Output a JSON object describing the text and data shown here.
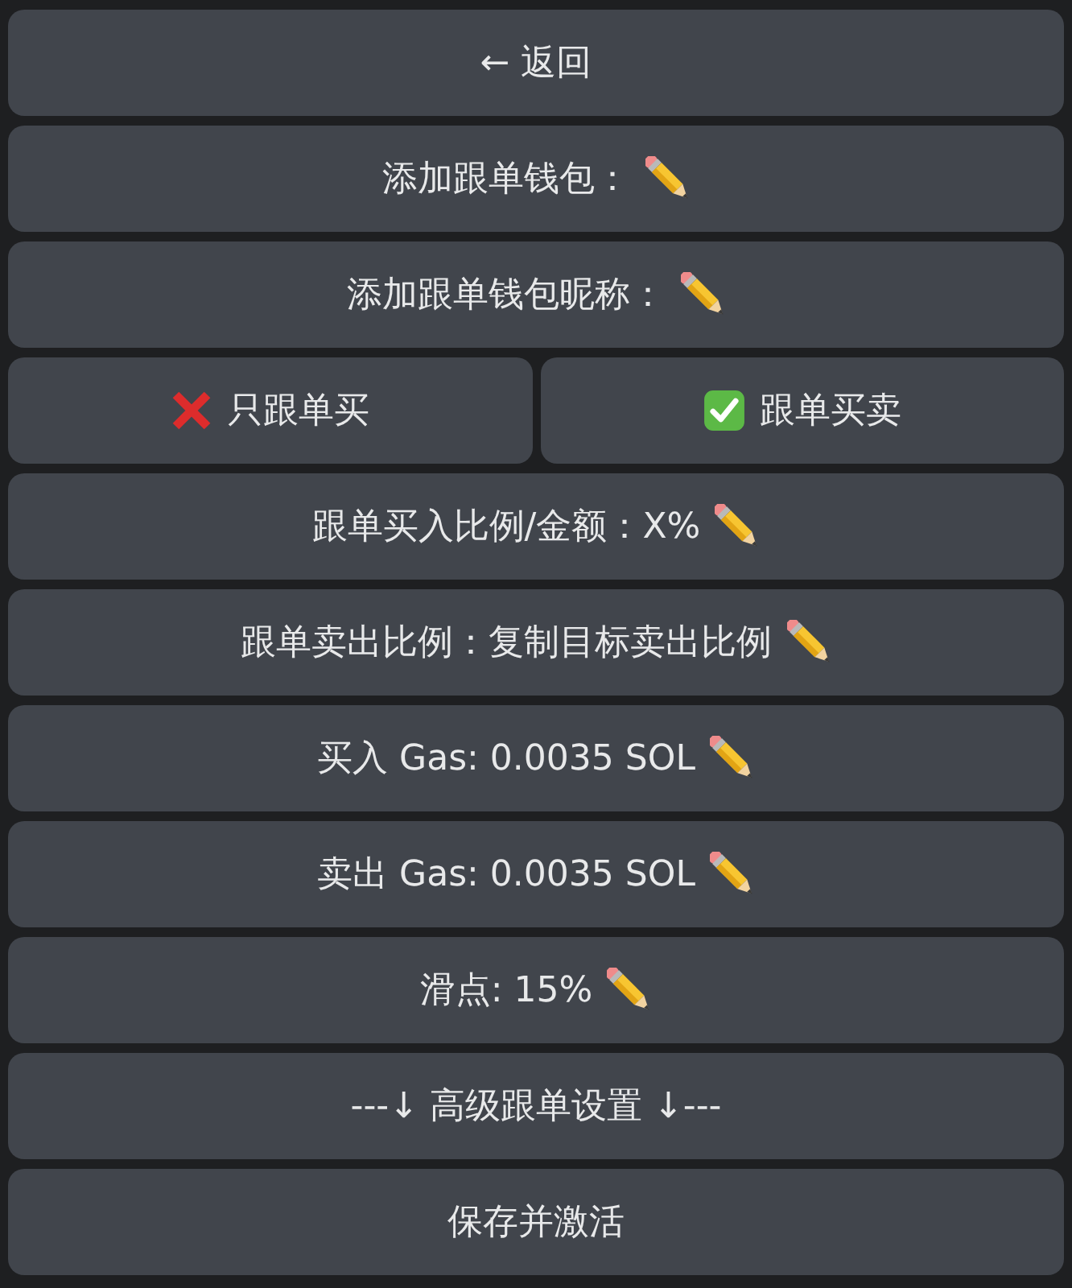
{
  "keyboard": {
    "rows": [
      {
        "buttons": [
          {
            "kind": "action",
            "label": "← 返回"
          }
        ]
      },
      {
        "buttons": [
          {
            "kind": "edit",
            "label": "添加跟单钱包："
          }
        ]
      },
      {
        "buttons": [
          {
            "kind": "edit",
            "label": "添加跟单钱包昵称："
          }
        ]
      },
      {
        "buttons": [
          {
            "kind": "option",
            "label": "只跟单买",
            "selected": false
          },
          {
            "kind": "option",
            "label": "跟单买卖",
            "selected": true
          }
        ]
      },
      {
        "buttons": [
          {
            "kind": "edit",
            "label": "跟单买入比例/金额：X%"
          }
        ]
      },
      {
        "buttons": [
          {
            "kind": "edit",
            "label": "跟单卖出比例：复制目标卖出比例"
          }
        ]
      },
      {
        "buttons": [
          {
            "kind": "edit",
            "label": "买入 Gas: 0.0035 SOL"
          }
        ]
      },
      {
        "buttons": [
          {
            "kind": "edit",
            "label": "卖出 Gas: 0.0035 SOL"
          }
        ]
      },
      {
        "buttons": [
          {
            "kind": "edit",
            "label": "滑点: 15%"
          }
        ]
      },
      {
        "buttons": [
          {
            "kind": "action",
            "label": "---↓ 高级跟单设置 ↓---"
          }
        ]
      },
      {
        "buttons": [
          {
            "kind": "action",
            "label": "保存并激活"
          }
        ]
      }
    ]
  }
}
